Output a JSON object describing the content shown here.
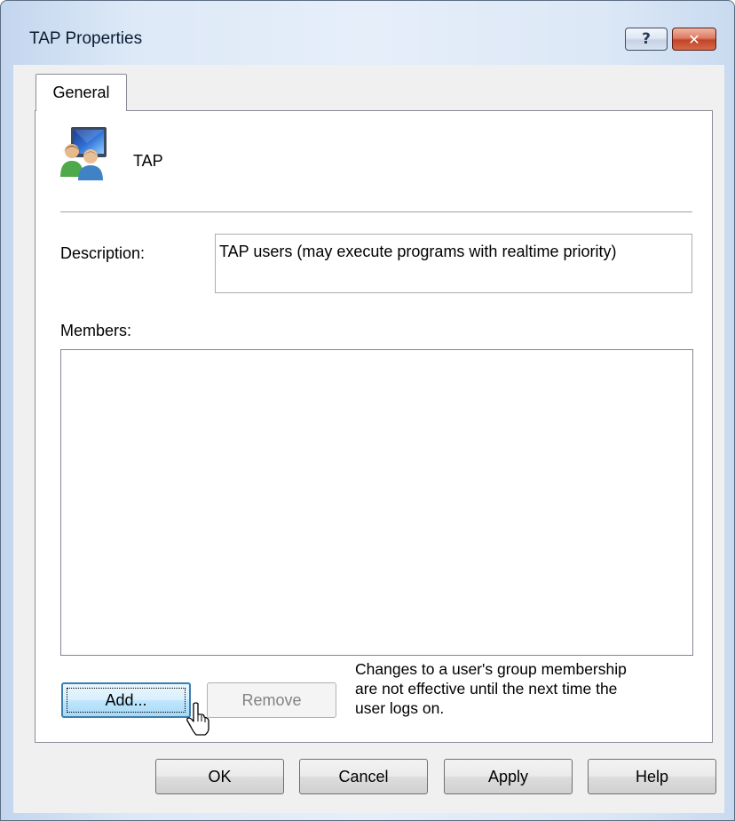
{
  "window": {
    "title": "TAP Properties",
    "help_glyph": "?",
    "close_glyph": "✕"
  },
  "tabs": [
    {
      "label": "General",
      "active": true
    }
  ],
  "general": {
    "group_icon": "group-users-icon",
    "group_name": "TAP",
    "description_label": "Description:",
    "description_value": "TAP users (may execute programs with realtime priority)",
    "members_label": "Members:",
    "members": [],
    "add_label": "Add...",
    "remove_label": "Remove",
    "note_lines": [
      "Changes to a user's group membership",
      "are not effective until the next time the",
      "user logs on."
    ]
  },
  "buttons": {
    "ok": "OK",
    "cancel": "Cancel",
    "apply": "Apply",
    "help": "Help"
  },
  "colors": {
    "accent_focus": "#3c7fb1",
    "close_red": "#c24428",
    "frame": "#dde9f7"
  }
}
